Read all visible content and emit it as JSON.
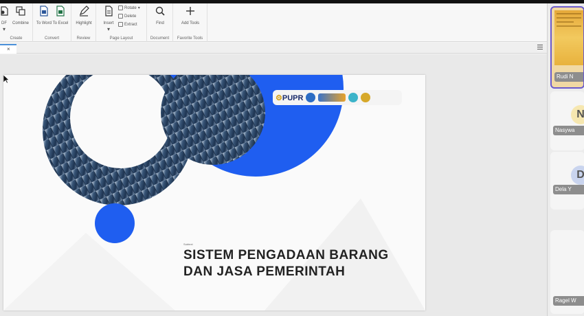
{
  "ribbon": {
    "groups": [
      {
        "name": "Create",
        "buttons": [
          {
            "label": "DF",
            "icon": "create-pdf-icon"
          },
          {
            "label": "Combine",
            "icon": "combine-icon"
          }
        ]
      },
      {
        "name": "Convert",
        "buttons": [
          {
            "label": "To Word",
            "icon": "word-icon"
          },
          {
            "label": "To Excel",
            "icon": "excel-icon"
          }
        ]
      },
      {
        "name": "Review",
        "buttons": [
          {
            "label": "Highlight",
            "icon": "highlight-icon"
          }
        ]
      },
      {
        "name": "Page Layout",
        "buttons": [
          {
            "label": "Insert",
            "icon": "insert-page-icon"
          }
        ],
        "small": [
          "Rotate",
          "Delete",
          "Extract"
        ]
      },
      {
        "name": "Document",
        "buttons": [
          {
            "label": "Find",
            "icon": "search-icon"
          }
        ]
      },
      {
        "name": "Favorite Tools",
        "buttons": [
          {
            "label": "Add Tools",
            "icon": "plus-icon"
          }
        ]
      }
    ]
  },
  "tab": {
    "close": "×"
  },
  "slide": {
    "logo_text_main": "PUPR",
    "subhead": "Subtext",
    "title_line1": "SISTEM PENGADAAN BARANG",
    "title_line2": "DAN JASA PEMERINTAH",
    "accent": "#1f5ef0"
  },
  "participants": [
    {
      "name": "Rudi N",
      "active": true
    },
    {
      "initial": "N",
      "name": "Nasywa",
      "avatar_color": "#f6e7b0"
    },
    {
      "initial": "D",
      "name": "Dela Y",
      "avatar_color": "#c9d4ee"
    },
    {
      "name": "Ragel W"
    }
  ]
}
